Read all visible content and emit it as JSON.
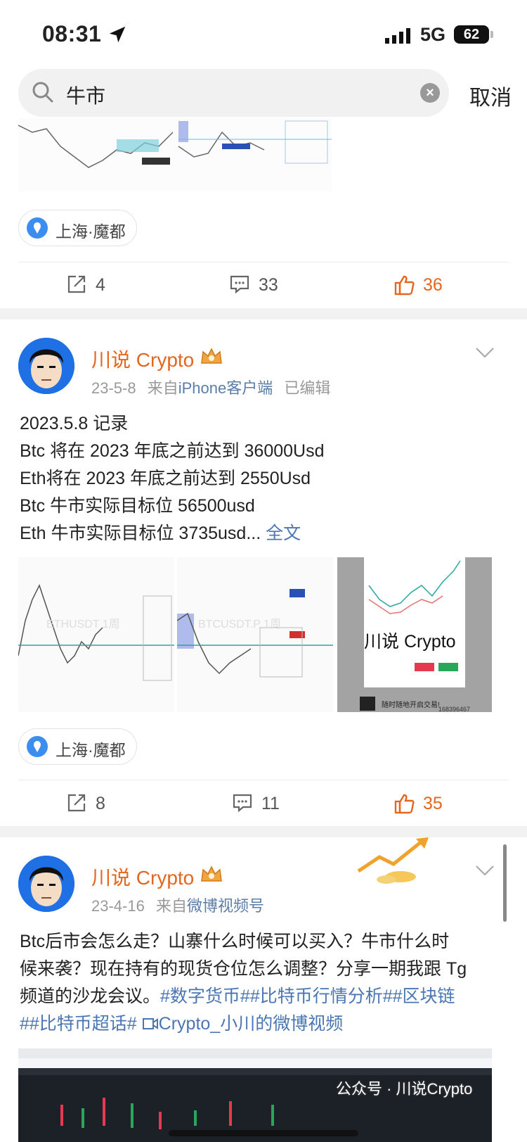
{
  "status_bar": {
    "time": "08:31",
    "network": "5G",
    "battery": "62"
  },
  "search": {
    "query": "牛市",
    "cancel_label": "取消"
  },
  "post1": {
    "location": "上海·魔都",
    "shares": "4",
    "comments": "33",
    "likes": "36"
  },
  "post2": {
    "author": "川说 Crypto",
    "date": "23-5-8",
    "source_prefix": "来自",
    "source": "iPhone客户端",
    "edited": "已编辑",
    "lines": [
      "2023.5.8 记录",
      "Btc 将在 2023 年底之前达到 36000Usd",
      "Eth将在 2023 年底之前达到 2550Usd",
      "Btc 牛市实际目标位 56500usd",
      "Eth 牛市实际目标位 3735usd..."
    ],
    "more_label": "全文",
    "image_overlay_text": "川说 Crypto",
    "image_caption": "随时随地开启交易!",
    "image_code": "168396467",
    "location": "上海·魔都",
    "shares": "8",
    "comments": "11",
    "likes": "35"
  },
  "post3": {
    "author": "川说 Crypto",
    "date": "23-4-16",
    "source_prefix": "来自",
    "source": "微博视频号",
    "line1": "Btc后市会怎么走？山寨什么时候可以买入？牛市什么时",
    "line2": "候来袭？现在持有的现货仓位怎么调整？分享一期我跟 Tg",
    "line3_plain": "频道的沙龙会议。",
    "line3_tags": "#数字货币##比特币行情分析##区块链",
    "line4_tag": "##比特币超话#",
    "line4_video": "Crypto_小川的微博视频"
  },
  "watermark": "公众号 · 川说Crypto",
  "colors": {
    "accent": "#e5661d",
    "link": "#4a76b3",
    "source": "#5b7ea8"
  },
  "icons": {
    "location": "location-pin-icon",
    "share": "share-icon",
    "comment": "comment-icon",
    "like": "thumbs-up-icon",
    "search": "search-icon",
    "clear": "clear-icon",
    "vip": "crown-badge-icon",
    "menu": "chevron-down-icon"
  }
}
